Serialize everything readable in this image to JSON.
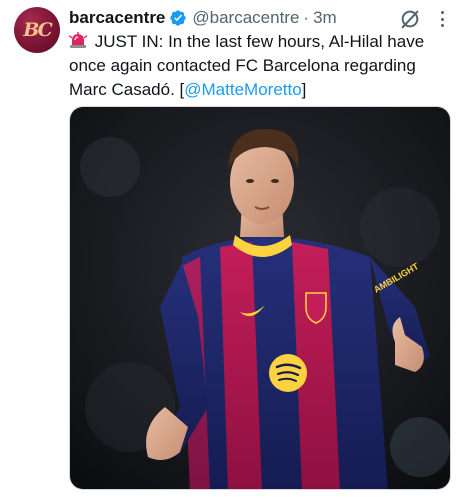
{
  "tweet": {
    "author_name": "barcacentre",
    "handle": "@barcacentre",
    "separator": "·",
    "time": "3m",
    "text_main": " JUST IN: In the last few hours, Al-Hilal have once again contacted FC Barcelona regarding Marc Casadó. [",
    "mention": "@MatteMoretto",
    "text_end": "]",
    "avatar_logo": "BC",
    "siren_icon": "siren-emoji-icon",
    "verified_color": "#1d9bf0"
  },
  "media": {
    "jersey_sponsor": "AMBILIGHT",
    "description_icon": "photo"
  }
}
